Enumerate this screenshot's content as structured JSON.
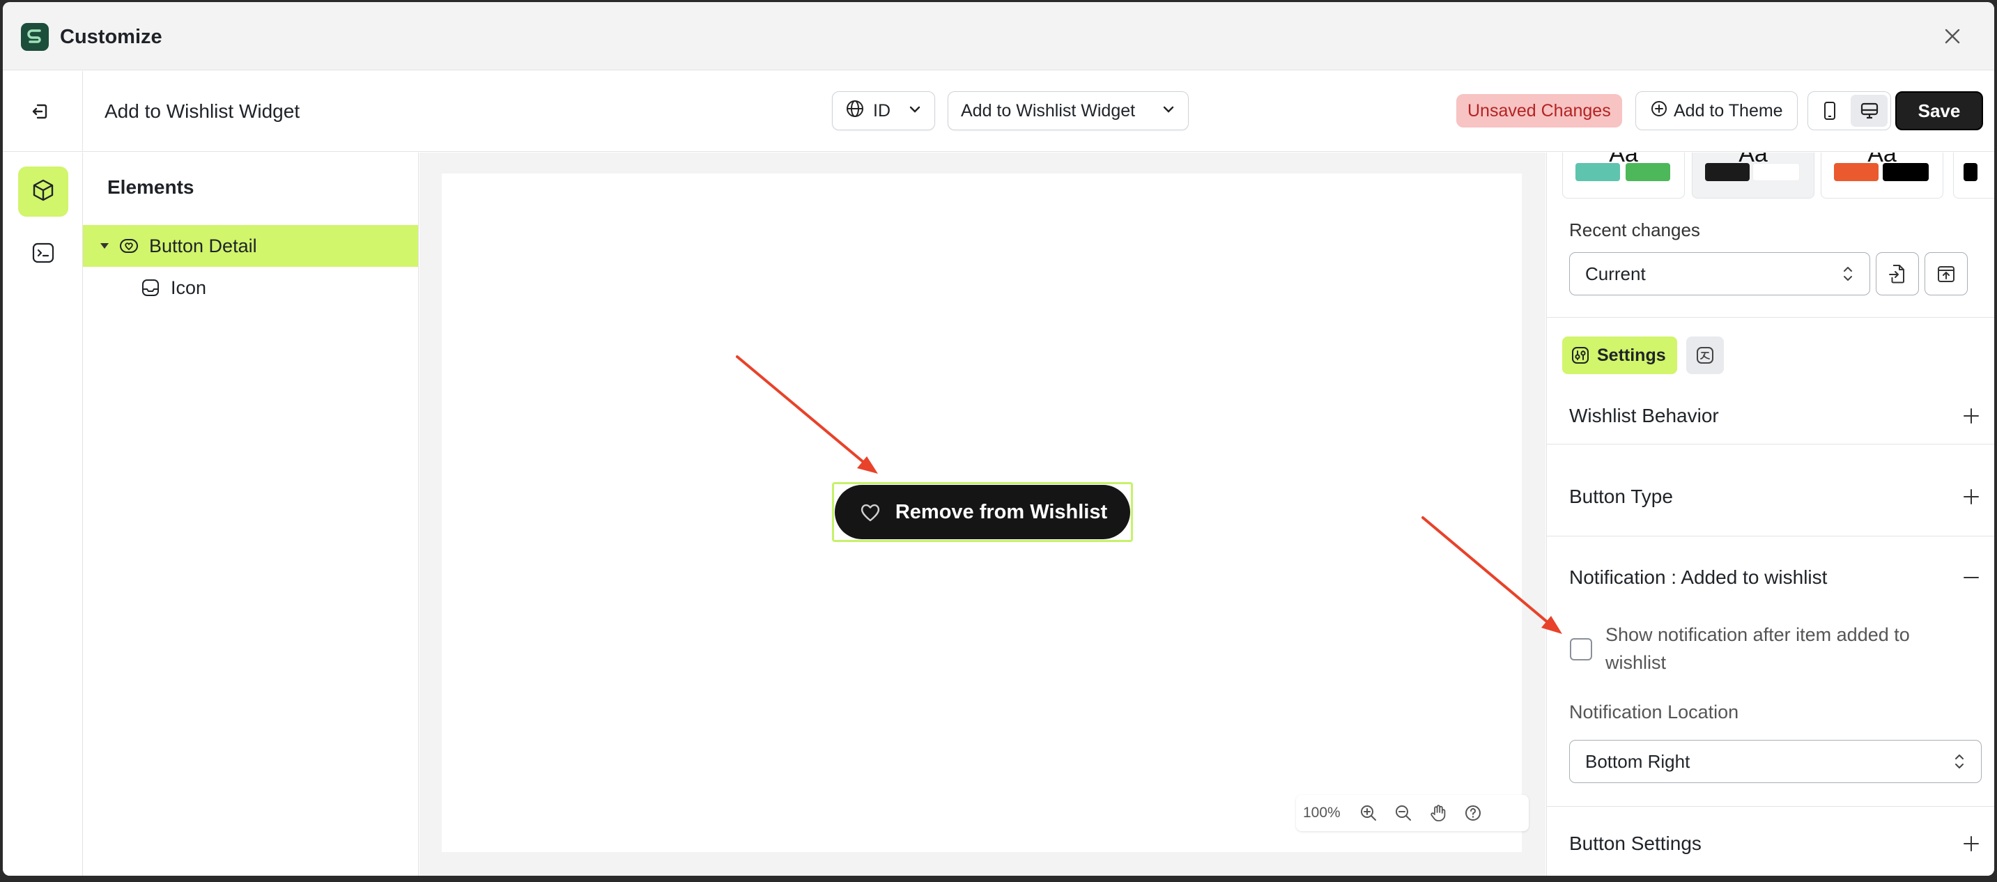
{
  "window": {
    "title": "Customize"
  },
  "toolbar": {
    "page_heading": "Add to Wishlist Widget",
    "language": "ID",
    "widget_selector": "Add to Wishlist Widget",
    "unsaved_badge": "Unsaved Changes",
    "add_to_theme_label": "Add to Theme",
    "save_label": "Save",
    "device_active": "desktop"
  },
  "elements_panel": {
    "title": "Elements",
    "tree": [
      {
        "label": "Button Detail",
        "selected": true,
        "expanded": true
      },
      {
        "label": "Icon",
        "selected": false
      }
    ]
  },
  "canvas": {
    "preview_button_label": "Remove from Wishlist",
    "zoom_level": "100%"
  },
  "right_panel": {
    "theme_cards": [
      {
        "label": "Aa",
        "swatches": [
          "#5ec4ad",
          "#4cb85a"
        ]
      },
      {
        "label": "Aa",
        "swatches": [
          "#1b1b1b",
          "#ffffff"
        ]
      },
      {
        "label": "Aa",
        "swatches": [
          "#ea5a2e",
          "#000000"
        ]
      }
    ],
    "recent_changes_label": "Recent changes",
    "recent_changes_value": "Current",
    "tabs": {
      "settings_label": "Settings"
    },
    "sections": {
      "wishlist_behavior": "Wishlist Behavior",
      "button_type": "Button Type",
      "notification": "Notification : Added to wishlist",
      "button_settings": "Button Settings"
    },
    "notification": {
      "checkbox_label": "Show notification after item added to wishlist",
      "checked": false,
      "location_label": "Notification Location",
      "location_value": "Bottom Right"
    }
  },
  "colors": {
    "accent": "#d1f56b",
    "unsaved_bg": "#f7c3c3",
    "unsaved_text": "#b42323",
    "annotation_arrow": "#e8422a"
  }
}
